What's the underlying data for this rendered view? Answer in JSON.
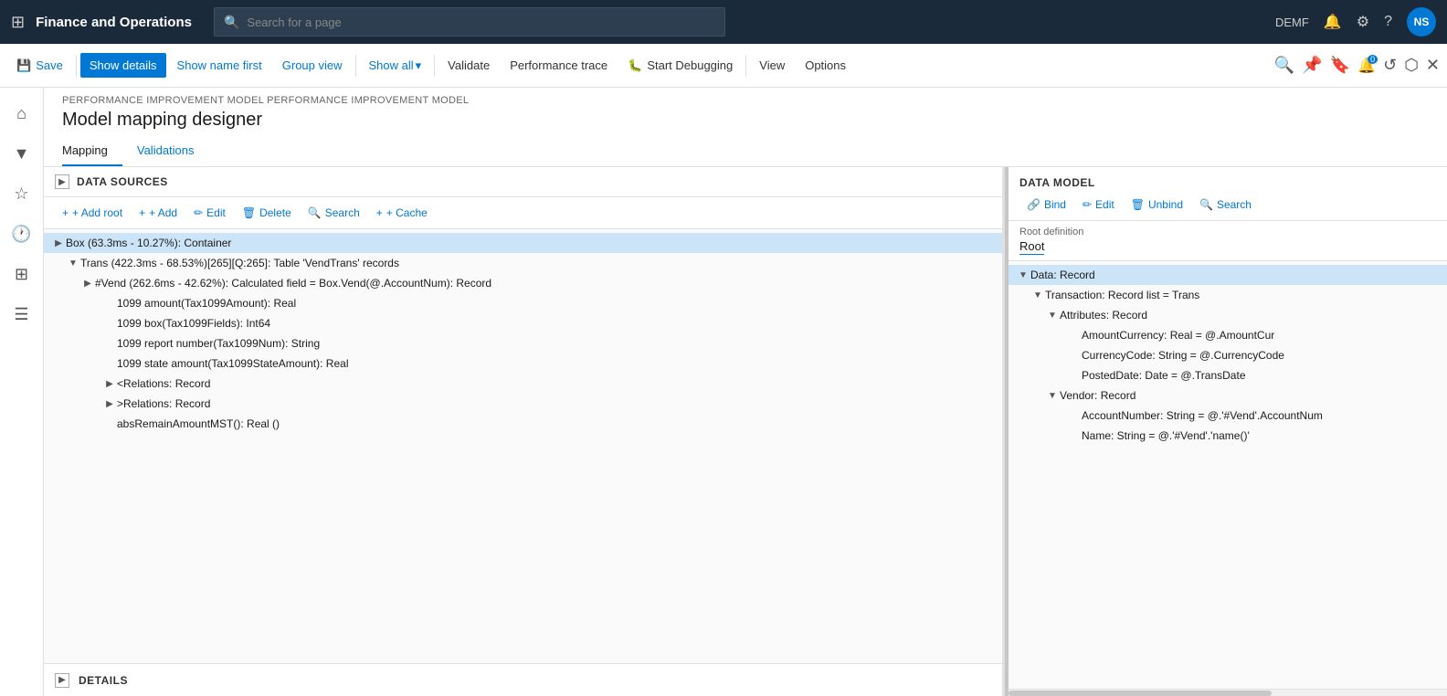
{
  "app": {
    "title": "Finance and Operations",
    "env": "DEMF",
    "avatar": "NS",
    "search_placeholder": "Search for a page"
  },
  "commandbar": {
    "save": "Save",
    "show_details": "Show details",
    "show_name_first": "Show name first",
    "group_view": "Group view",
    "show_all": "Show all",
    "validate": "Validate",
    "performance_trace": "Performance trace",
    "start_debugging": "Start Debugging",
    "view": "View",
    "options": "Options"
  },
  "breadcrumb": "PERFORMANCE IMPROVEMENT MODEL PERFORMANCE IMPROVEMENT MODEL",
  "page_title": "Model mapping designer",
  "tabs": [
    "Mapping",
    "Validations"
  ],
  "active_tab": "Mapping",
  "left_pane": {
    "title": "DATA SOURCES",
    "toolbar": {
      "add_root": "+ Add root",
      "add": "+ Add",
      "edit": "Edit",
      "delete": "Delete",
      "search": "Search",
      "cache": "+ Cache"
    },
    "tree": [
      {
        "id": "box",
        "text": "Box (63.3ms - 10.27%): Container",
        "selected": true,
        "expanded": true,
        "level": 0,
        "hasChildren": true
      },
      {
        "id": "trans",
        "text": "Trans (422.3ms - 68.53%)[265][Q:265]: Table 'VendTrans' records",
        "selected": false,
        "expanded": true,
        "level": 1,
        "hasChildren": true
      },
      {
        "id": "vend",
        "text": "#Vend (262.6ms - 42.62%): Calculated field = Box.Vend(@.AccountNum): Record",
        "selected": false,
        "expanded": false,
        "level": 2,
        "hasChildren": true
      },
      {
        "id": "tax1099amount",
        "text": "1099 amount(Tax1099Amount): Real",
        "selected": false,
        "expanded": false,
        "level": 3,
        "hasChildren": false
      },
      {
        "id": "tax1099fields",
        "text": "1099 box(Tax1099Fields): Int64",
        "selected": false,
        "expanded": false,
        "level": 3,
        "hasChildren": false
      },
      {
        "id": "tax1099num",
        "text": "1099 report number(Tax1099Num): String",
        "selected": false,
        "expanded": false,
        "level": 3,
        "hasChildren": false
      },
      {
        "id": "tax1099stateamount",
        "text": "1099 state amount(Tax1099StateAmount): Real",
        "selected": false,
        "expanded": false,
        "level": 3,
        "hasChildren": false
      },
      {
        "id": "relations1",
        "text": "<Relations: Record",
        "selected": false,
        "expanded": false,
        "level": 3,
        "hasChildren": true
      },
      {
        "id": "relations2",
        "text": ">Relations: Record",
        "selected": false,
        "expanded": false,
        "level": 3,
        "hasChildren": true
      },
      {
        "id": "absremain",
        "text": "absRemainAmountMST(): Real ()",
        "selected": false,
        "expanded": false,
        "level": 3,
        "hasChildren": false
      }
    ]
  },
  "right_pane": {
    "title": "DATA MODEL",
    "toolbar": {
      "bind": "Bind",
      "edit": "Edit",
      "unbind": "Unbind",
      "search": "Search"
    },
    "root_definition_label": "Root definition",
    "root_definition_value": "Root",
    "tree": [
      {
        "id": "data",
        "text": "Data: Record",
        "selected": true,
        "expanded": true,
        "level": 0,
        "hasChildren": true
      },
      {
        "id": "transaction",
        "text": "Transaction: Record list = Trans",
        "selected": false,
        "expanded": true,
        "level": 1,
        "hasChildren": true
      },
      {
        "id": "attributes",
        "text": "Attributes: Record",
        "selected": false,
        "expanded": true,
        "level": 2,
        "hasChildren": true
      },
      {
        "id": "amountcurrency",
        "text": "AmountCurrency: Real = @.AmountCur",
        "selected": false,
        "level": 3,
        "hasChildren": false
      },
      {
        "id": "currencycode",
        "text": "CurrencyCode: String = @.CurrencyCode",
        "selected": false,
        "level": 3,
        "hasChildren": false
      },
      {
        "id": "posteddate",
        "text": "PostedDate: Date = @.TransDate",
        "selected": false,
        "level": 3,
        "hasChildren": false
      },
      {
        "id": "vendor",
        "text": "Vendor: Record",
        "selected": false,
        "expanded": true,
        "level": 2,
        "hasChildren": true
      },
      {
        "id": "accountnumber",
        "text": "AccountNumber: String = @.'#Vend'.AccountNum",
        "selected": false,
        "level": 3,
        "hasChildren": false
      },
      {
        "id": "name",
        "text": "Name: String = @.'#Vend'.'name()'",
        "selected": false,
        "level": 3,
        "hasChildren": false
      }
    ]
  },
  "bottom_panel": {
    "title": "DETAILS"
  }
}
